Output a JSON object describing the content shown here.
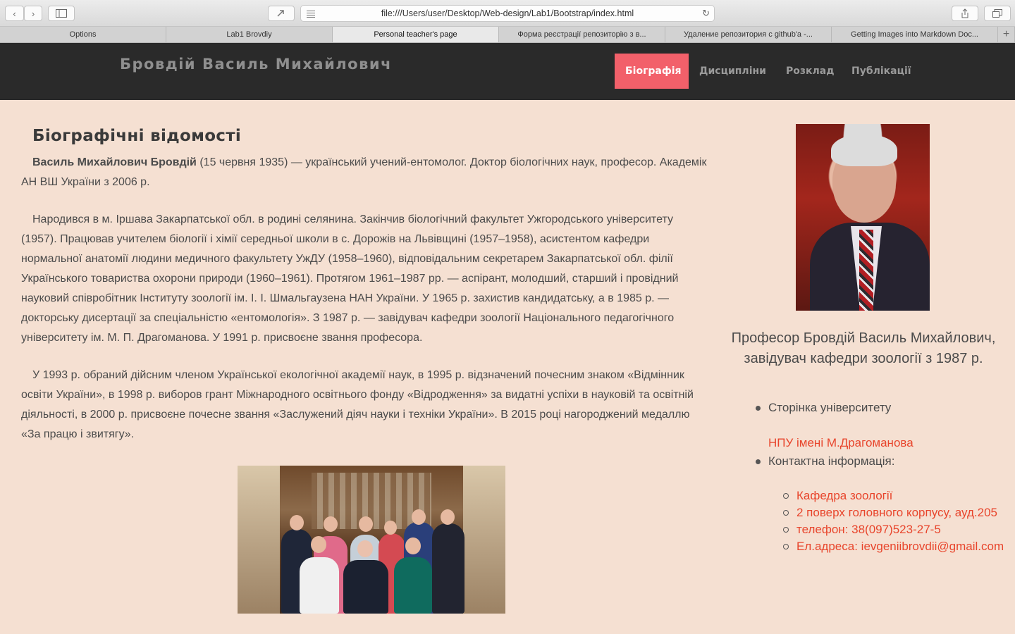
{
  "browser": {
    "url": "file:///Users/user/Desktop/Web-design/Lab1/Bootstrap/index.html",
    "tabs": [
      {
        "label": "Options",
        "active": false
      },
      {
        "label": "Lab1 Brovdiy",
        "active": false
      },
      {
        "label": "Personal teacher's page",
        "active": true
      },
      {
        "label": "Форма реєстрації репозиторію з в...",
        "active": false
      },
      {
        "label": "Удаление репозитория с github'а -...",
        "active": false
      },
      {
        "label": "Getting Images into Markdown Doc...",
        "active": false
      }
    ],
    "icons": [
      "back-icon",
      "forward-icon",
      "sidebar-icon",
      "extensions-icon",
      "reader-icon",
      "reload-icon",
      "share-icon",
      "tabs-overview-icon",
      "new-tab-icon"
    ]
  },
  "nav": {
    "brand": "Бровдій Василь Михайлович",
    "items": [
      "Біографія",
      "Дисципліни",
      "Розклад",
      "Публікації"
    ],
    "active_color": "#f2606a"
  },
  "main": {
    "heading": "Біографічні відомості",
    "p1_name": "Василь Михайлович Бровдій",
    "p1_text": " (15 червня 1935) — український учений-ентомолог. Доктор біологічних наук, професор. Академік АН ВШ України з 2006 р.",
    "p2": "Народився в м. Іршава Закарпатської обл. в родині селянина. Закінчив біологічний факультет Ужгородського університету (1957). Працював учителем біології і хімії середньої школи в с. Дорожів на Львівщині (1957–1958), асистентом кафедри нормальної анатомії людини медичного факультету УжДУ (1958–1960), відповідальним секретарем Закарпатської обл. філії Українського товариства охорони природи (1960–1961). Протягом 1961–1987 рр. — аспірант, молодший, старший і провідний науковий співробітник Інституту зоології ім. І. І. Шмальгаузена НАН України. У 1965 р. захистив кандидатську, а в 1985 р. — докторську дисертації за спеціальністю «ентомологія». З 1987 р. — завідувач кафедри зоології Національного педагогічного університету ім. М. П. Драгоманова. У 1991 р. присвоєне звання професора.",
    "p3": "У 1993 р. обраний дійсним членом Української екологічної академії наук, в 1995 р. відзначений почесним знаком «Відмінник освіти України», в 1998 р. виборов грант Міжнародного освітнього фонду «Відродження» за видатні успіхи в науковій та освітній діяльності, в 2000 р. присвоєне почесне звання «Заслужений діяч науки і техніки України». В 2015 році нагороджений медаллю «За працю і звитягу»."
  },
  "sidebar": {
    "caption": "Професор Бровдій Василь Михайлович, завідувач кафедри зоології з 1987 р.",
    "university_label": "Сторінка університету",
    "university_link": "НПУ імені М.Драгоманова",
    "contacts_label": "Контактна інформація:",
    "contacts": [
      "Кафедра зоології",
      "2 поверх головного корпусу, ауд.205",
      "телефон: 38(097)523-27-5",
      "Ел.адреса: ievgeniibrovdii@gmail.com"
    ],
    "link_color": "#e8452c"
  }
}
